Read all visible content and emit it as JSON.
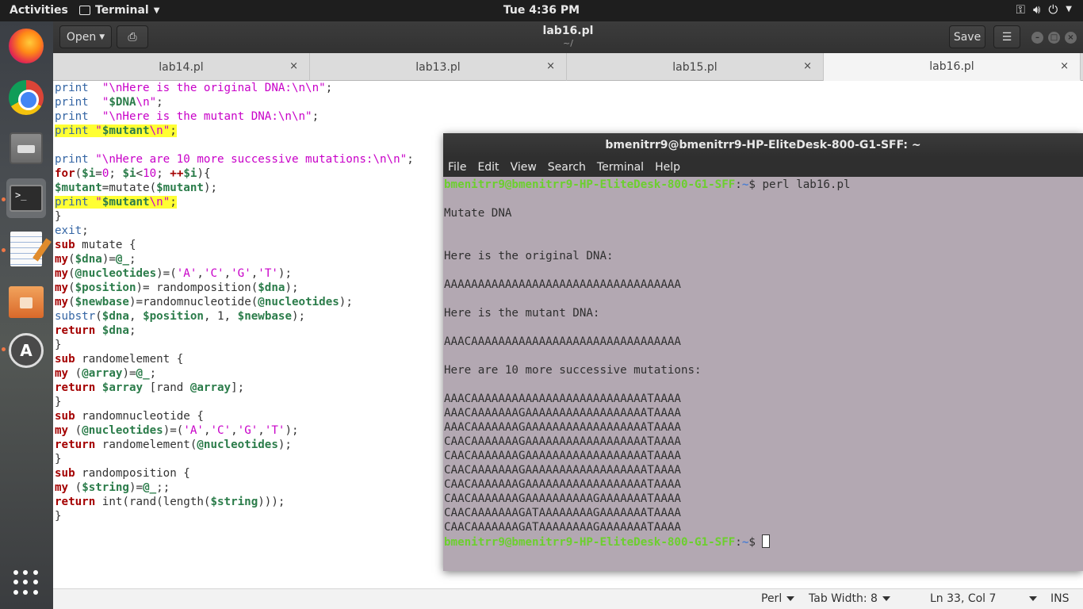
{
  "topbar": {
    "activities": "Activities",
    "app_name": "Terminal",
    "clock": "Tue  4:36 PM"
  },
  "dock": {
    "items": [
      "firefox",
      "chrome",
      "files",
      "terminal",
      "text-editor",
      "archive",
      "software-updater",
      "show-applications"
    ]
  },
  "gedit": {
    "open_label": "Open",
    "save_label": "Save",
    "title": "lab16.pl",
    "subtitle": "~/",
    "tabs": [
      {
        "label": "lab14.pl",
        "close": "×"
      },
      {
        "label": "lab13.pl",
        "close": "×"
      },
      {
        "label": "lab15.pl",
        "close": "×"
      },
      {
        "label": "lab16.pl",
        "close": "×"
      }
    ],
    "active_tab": "lab16.pl",
    "code_lines": [
      [
        [
          "fn",
          "print"
        ],
        [
          "",
          "  "
        ],
        [
          "str",
          "\"\\nHere is the original DNA:\\n\\n\""
        ],
        [
          "",
          ";"
        ]
      ],
      [
        [
          "fn",
          "print"
        ],
        [
          "",
          "  "
        ],
        [
          "str",
          "\""
        ],
        [
          "var",
          "$DNA"
        ],
        [
          "str",
          "\\n\""
        ],
        [
          "",
          ";"
        ]
      ],
      [
        [
          "fn",
          "print"
        ],
        [
          "",
          "  "
        ],
        [
          "str",
          "\"\\nHere is the mutant DNA:\\n\\n\""
        ],
        [
          "",
          ";"
        ]
      ],
      [
        [
          "fn",
          "print"
        ],
        [
          "",
          " "
        ],
        [
          "str",
          "\""
        ],
        [
          "var",
          "$mutant"
        ],
        [
          "str",
          "\\n\""
        ],
        [
          "",
          ";"
        ]
      ],
      [],
      [
        [
          "fn",
          "print"
        ],
        [
          "",
          " "
        ],
        [
          "str",
          "\"\\nHere are 10 more successive mutations:\\n\\n\""
        ],
        [
          "",
          ";"
        ]
      ],
      [
        [
          "kw",
          "for"
        ],
        [
          "",
          "("
        ],
        [
          "var",
          "$i"
        ],
        [
          "",
          "="
        ],
        [
          "num",
          "0"
        ],
        [
          "",
          "; "
        ],
        [
          "var",
          "$i"
        ],
        [
          "",
          "<"
        ],
        [
          "num",
          "10"
        ],
        [
          "",
          "; "
        ],
        [
          "kw",
          "++"
        ],
        [
          "var",
          "$i"
        ],
        [
          "",
          ")"
        ],
        [
          "",
          "{"
        ]
      ],
      [
        [
          "var",
          "$mutant"
        ],
        [
          "",
          "="
        ],
        [
          "",
          "mutate("
        ],
        [
          "var",
          "$mutant"
        ],
        [
          "",
          ");"
        ]
      ],
      [
        [
          "fn",
          "print"
        ],
        [
          "",
          " "
        ],
        [
          "str",
          "\""
        ],
        [
          "var",
          "$mutant"
        ],
        [
          "str",
          "\\n\""
        ],
        [
          "",
          ";"
        ]
      ],
      [
        [
          "",
          "}"
        ]
      ],
      [
        [
          "fn",
          "exit"
        ],
        [
          "",
          ";"
        ]
      ],
      [
        [
          "kw",
          "sub"
        ],
        [
          "",
          " mutate {"
        ]
      ],
      [
        [
          "kw",
          "my"
        ],
        [
          "",
          "("
        ],
        [
          "var",
          "$dna"
        ],
        [
          "",
          ")="
        ],
        [
          "var",
          "@_"
        ],
        [
          "",
          ";"
        ]
      ],
      [
        [
          "kw",
          "my"
        ],
        [
          "",
          "("
        ],
        [
          "var",
          "@nucleotides"
        ],
        [
          "",
          ")=("
        ],
        [
          "str",
          "'A'"
        ],
        [
          "",
          ","
        ],
        [
          "str",
          "'C'"
        ],
        [
          "",
          ","
        ],
        [
          "str",
          "'G'"
        ],
        [
          "",
          ","
        ],
        [
          "str",
          "'T'"
        ],
        [
          "",
          ");"
        ]
      ],
      [
        [
          "kw",
          "my"
        ],
        [
          "",
          "("
        ],
        [
          "var",
          "$position"
        ],
        [
          "",
          ")= randomposition("
        ],
        [
          "var",
          "$dna"
        ],
        [
          "",
          ");"
        ]
      ],
      [
        [
          "kw",
          "my"
        ],
        [
          "",
          "("
        ],
        [
          "var",
          "$newbase"
        ],
        [
          "",
          ")=randomnucleotide("
        ],
        [
          "var",
          "@nucleotides"
        ],
        [
          "",
          ");"
        ]
      ],
      [
        [
          "fn",
          "substr"
        ],
        [
          "",
          "("
        ],
        [
          "var",
          "$dna"
        ],
        [
          "",
          ", "
        ],
        [
          "var",
          "$position"
        ],
        [
          "",
          ", 1, "
        ],
        [
          "var",
          "$newbase"
        ],
        [
          "",
          ");"
        ]
      ],
      [
        [
          "kw",
          "return"
        ],
        [
          "",
          " "
        ],
        [
          "var",
          "$dna"
        ],
        [
          "",
          ";"
        ]
      ],
      [
        [
          "",
          "}"
        ]
      ],
      [
        [
          "kw",
          "sub"
        ],
        [
          "",
          " randomelement {"
        ]
      ],
      [
        [
          "kw",
          "my"
        ],
        [
          "",
          " ("
        ],
        [
          "var",
          "@array"
        ],
        [
          "",
          ")="
        ],
        [
          "var",
          "@_"
        ],
        [
          "",
          ";"
        ]
      ],
      [
        [
          "kw",
          "return"
        ],
        [
          "",
          " "
        ],
        [
          "var",
          "$array"
        ],
        [
          "",
          " [rand "
        ],
        [
          "var",
          "@array"
        ],
        [
          "",
          "];"
        ]
      ],
      [
        [
          "",
          "}"
        ]
      ],
      [
        [
          "kw",
          "sub"
        ],
        [
          "",
          " randomnucleotide {"
        ]
      ],
      [
        [
          "kw",
          "my"
        ],
        [
          "",
          " ("
        ],
        [
          "var",
          "@nucleotides"
        ],
        [
          "",
          ")=("
        ],
        [
          "str",
          "'A'"
        ],
        [
          "",
          ","
        ],
        [
          "str",
          "'C'"
        ],
        [
          "",
          ","
        ],
        [
          "str",
          "'G'"
        ],
        [
          "",
          ","
        ],
        [
          "str",
          "'T'"
        ],
        [
          "",
          ");"
        ]
      ],
      [
        [
          "kw",
          "return"
        ],
        [
          "",
          " randomelement("
        ],
        [
          "var",
          "@nucleotides"
        ],
        [
          "",
          ");"
        ]
      ],
      [
        [
          "",
          "}"
        ]
      ],
      [
        [
          "kw",
          "sub"
        ],
        [
          "",
          " randomposition {"
        ]
      ],
      [
        [
          "kw",
          "my"
        ],
        [
          "",
          " ("
        ],
        [
          "var",
          "$string"
        ],
        [
          "",
          ")="
        ],
        [
          "var",
          "@_"
        ],
        [
          "",
          ";;"
        ]
      ],
      [
        [
          "kw",
          "return"
        ],
        [
          "",
          " int(rand(length("
        ],
        [
          "var",
          "$string"
        ],
        [
          "",
          ")));"
        ]
      ],
      [
        [
          "",
          "}"
        ]
      ]
    ],
    "highlighted_lines": [
      3,
      8
    ],
    "status": {
      "language": "Perl",
      "tab_width": "Tab Width: 8",
      "position": "Ln 33, Col 7",
      "mode": "INS"
    }
  },
  "terminal": {
    "title": "bmenitrr9@bmenitrr9-HP-EliteDesk-800-G1-SFF: ~",
    "menu": [
      "File",
      "Edit",
      "View",
      "Search",
      "Terminal",
      "Help"
    ],
    "prompt_user": "bmenitrr9@bmenitrr9-HP-EliteDesk-800-G1-SFF",
    "prompt_path": "~",
    "command": "perl lab16.pl",
    "output": [
      "",
      "Mutate DNA",
      "",
      "",
      "Here is the original DNA:",
      "",
      "AAAAAAAAAAAAAAAAAAAAAAAAAAAAAAAAAAA",
      "",
      "Here is the mutant DNA:",
      "",
      "AAACAAAAAAAAAAAAAAAAAAAAAAAAAAAAAAA",
      "",
      "Here are 10 more successive mutations:",
      "",
      "AAACAAAAAAAAAAAAAAAAAAAAAAAAAATAAAA",
      "AAACAAAAAAAGAAAAAAAAAAAAAAAAAATAAAA",
      "AAACAAAAAAAGAAAAAAAAAAAAAAAAAATAAAA",
      "CAACAAAAAAAGAAAAAAAAAAAAAAAAAATAAAA",
      "CAACAAAAAAAGAAAAAAAAAAAAAAAAAATAAAA",
      "CAACAAAAAAAGAAAAAAAAAAAAAAAAAATAAAA",
      "CAACAAAAAAAGAAAAAAAAAAAAAAAAAATAAAA",
      "CAACAAAAAAAGAAAAAAAAAAGAAAAAAATAAAA",
      "CAACAAAAAAAGATAAAAAAAAGAAAAAAATAAAA",
      "CAACAAAAAAAGATAAAAAAAAGAAAAAAATAAAA"
    ]
  }
}
